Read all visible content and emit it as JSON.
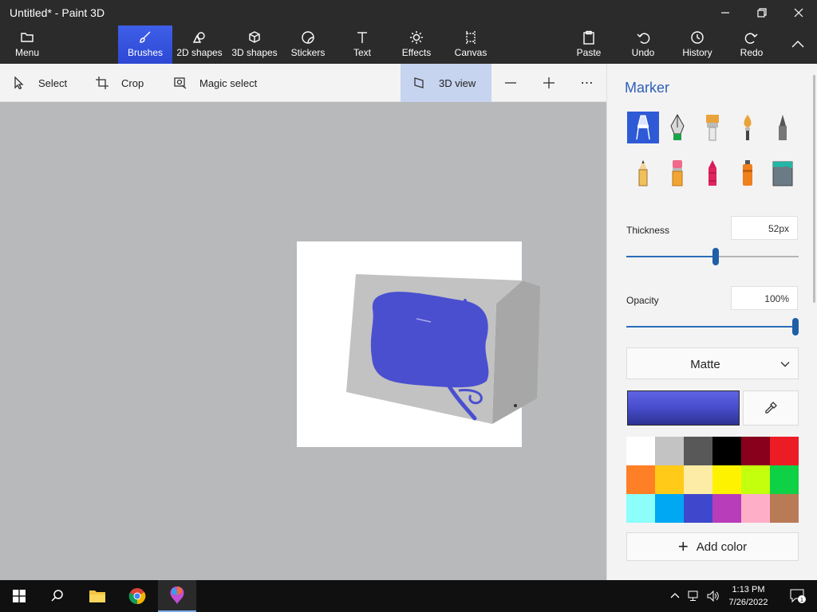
{
  "window": {
    "title": "Untitled* - Paint 3D"
  },
  "ribbon": {
    "menu": "Menu",
    "brushes": "Brushes",
    "shapes2d": "2D shapes",
    "shapes3d": "3D shapes",
    "stickers": "Stickers",
    "text": "Text",
    "effects": "Effects",
    "canvas": "Canvas",
    "paste": "Paste",
    "undo": "Undo",
    "history": "History",
    "redo": "Redo",
    "active": "Brushes"
  },
  "toolbar": {
    "select": "Select",
    "crop": "Crop",
    "magic_select": "Magic select",
    "view3d": "3D view"
  },
  "panel": {
    "title": "Marker",
    "tools": [
      "marker",
      "calligraphy-pen",
      "oil-brush",
      "watercolor",
      "pixel-pen",
      "pencil",
      "eraser",
      "crayon",
      "spray-can",
      "fill"
    ],
    "selected_tool": "marker",
    "thickness_label": "Thickness",
    "thickness_value": "52px",
    "thickness_fraction": 0.52,
    "opacity_label": "Opacity",
    "opacity_value": "100%",
    "opacity_fraction": 1.0,
    "finish": "Matte",
    "current_color": "#4a4fd0",
    "palette": [
      "#ffffff",
      "#c3c3c3",
      "#585858",
      "#000000",
      "#88001b",
      "#ec1c24",
      "#ff7f27",
      "#ffca18",
      "#fdeca6",
      "#fff200",
      "#c4ff0e",
      "#0ed145",
      "#8cfffb",
      "#00a8f3",
      "#3f48cc",
      "#b83dba",
      "#ffaec8",
      "#b97a56"
    ],
    "add_color": "Add color"
  },
  "taskbar": {
    "time": "1:13 PM",
    "date": "7/26/2022",
    "notification_count": "1"
  }
}
